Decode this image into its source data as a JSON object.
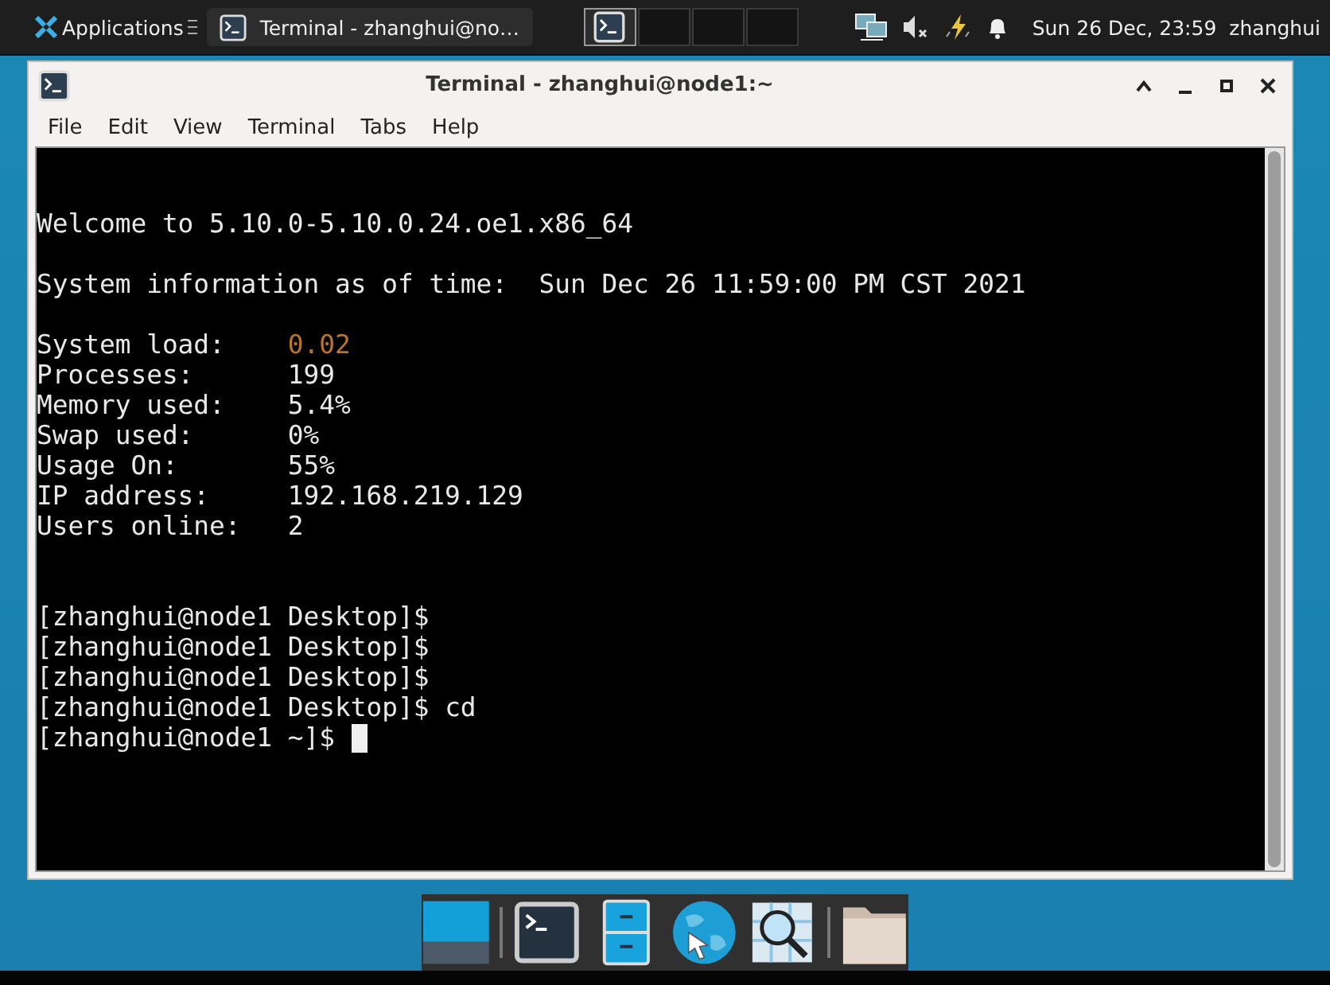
{
  "top_panel": {
    "apps_menu": "Applications",
    "tasks": [
      {
        "label": "Terminal - zhanghui@no…",
        "selected": true
      }
    ],
    "workspaces": [
      {
        "selected": true
      },
      {
        "selected": false
      },
      {
        "selected": false
      },
      {
        "selected": false
      }
    ],
    "clock": "Sun 26 Dec, 23:59",
    "user": "zhanghui"
  },
  "window": {
    "title": "Terminal - zhanghui@node1:~",
    "menu": [
      "File",
      "Edit",
      "View",
      "Terminal",
      "Tabs",
      "Help"
    ]
  },
  "terminal": {
    "lines": [
      {
        "kind": "blank"
      },
      {
        "kind": "blank"
      },
      {
        "kind": "text",
        "text": "Welcome to 5.10.0-5.10.0.24.oe1.x86_64"
      },
      {
        "kind": "blank"
      },
      {
        "kind": "text",
        "text": "System information as of time:  Sun Dec 26 11:59:00 PM CST 2021"
      },
      {
        "kind": "blank"
      },
      {
        "kind": "field",
        "label": "System load:",
        "value": "0.02",
        "color": "#b8742e"
      },
      {
        "kind": "field",
        "label": "Processes:",
        "value": "199",
        "color": "#e8e8e8"
      },
      {
        "kind": "field",
        "label": "Memory used:",
        "value": "5.4%",
        "color": "#e8e8e8"
      },
      {
        "kind": "field",
        "label": "Swap used:",
        "value": "0%",
        "color": "#e8e8e8"
      },
      {
        "kind": "field",
        "label": "Usage On:",
        "value": "55%",
        "color": "#e8e8e8"
      },
      {
        "kind": "field",
        "label": "IP address:",
        "value": "192.168.219.129",
        "color": "#e8e8e8"
      },
      {
        "kind": "field",
        "label": "Users online:",
        "value": "2",
        "color": "#e8e8e8"
      },
      {
        "kind": "blank"
      },
      {
        "kind": "blank"
      },
      {
        "kind": "prompt",
        "text": "[zhanghui@node1 Desktop]$",
        "cursor": false
      },
      {
        "kind": "prompt",
        "text": "[zhanghui@node1 Desktop]$",
        "cursor": false
      },
      {
        "kind": "prompt",
        "text": "[zhanghui@node1 Desktop]$",
        "cursor": false
      },
      {
        "kind": "prompt",
        "text": "[zhanghui@node1 Desktop]$ cd",
        "cursor": false
      },
      {
        "kind": "prompt",
        "text": "[zhanghui@node1 ~]$",
        "cursor": true
      }
    ]
  },
  "dock": {
    "items": [
      {
        "kind": "desktop"
      },
      {
        "kind": "separator"
      },
      {
        "kind": "terminal"
      },
      {
        "kind": "cabinet"
      },
      {
        "kind": "browser"
      },
      {
        "kind": "finder"
      },
      {
        "kind": "separator"
      },
      {
        "kind": "folder"
      }
    ]
  }
}
